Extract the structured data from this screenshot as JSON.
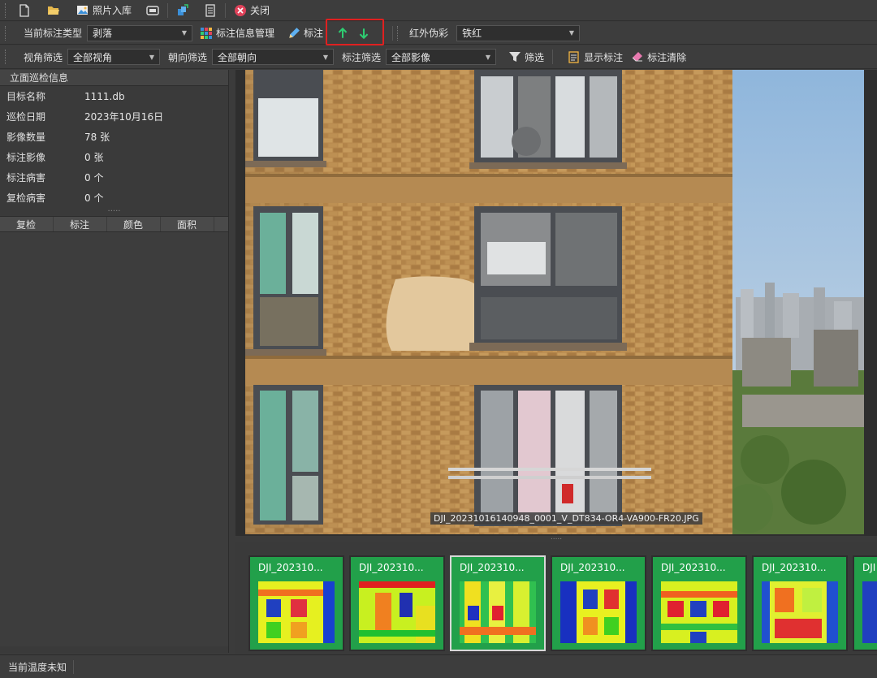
{
  "toolbar1": {
    "photo_import": "照片入库",
    "close": "关闭"
  },
  "toolbar2": {
    "label_type_label": "当前标注类型",
    "label_type_value": "剥落",
    "label_info_mgmt": "标注信息管理",
    "label_btn": "标注",
    "infrared_label": "红外伪彩",
    "infrared_value": "铁红"
  },
  "toolbar3": {
    "view_filter_label": "视角筛选",
    "view_filter_value": "全部视角",
    "orient_filter_label": "朝向筛选",
    "orient_filter_value": "全部朝向",
    "mark_filter_label": "标注筛选",
    "mark_filter_value": "全部影像",
    "filter_btn": "筛选",
    "show_marks": "显示标注",
    "clear_marks": "标注清除"
  },
  "panel": {
    "title": "立面巡检信息",
    "rows": [
      {
        "k": "目标名称",
        "v": "1111.db"
      },
      {
        "k": "巡检日期",
        "v": "2023年10月16日"
      },
      {
        "k": "影像数量",
        "v": "78 张"
      },
      {
        "k": "标注影像",
        "v": "0 张"
      },
      {
        "k": "标注病害",
        "v": "0 个"
      },
      {
        "k": "复检病害",
        "v": "0 个"
      }
    ],
    "columns": [
      "复检",
      "标注",
      "颜色",
      "面积"
    ]
  },
  "viewer": {
    "filename": "DJI_20231016140948_0001_V_DT834-OR4-VA900-FR20.JPG"
  },
  "thumbnails": [
    {
      "title": "DJI_202310..."
    },
    {
      "title": "DJI_202310..."
    },
    {
      "title": "DJI_202310..."
    },
    {
      "title": "DJI_202310..."
    },
    {
      "title": "DJI_202310..."
    },
    {
      "title": "DJI_202310..."
    },
    {
      "title": "DJI"
    }
  ],
  "status": {
    "temperature": "当前温度未知"
  },
  "colors": {
    "accent_green": "#22a04a",
    "arrow_green": "#2ecc71",
    "highlight_red": "#e02020"
  }
}
